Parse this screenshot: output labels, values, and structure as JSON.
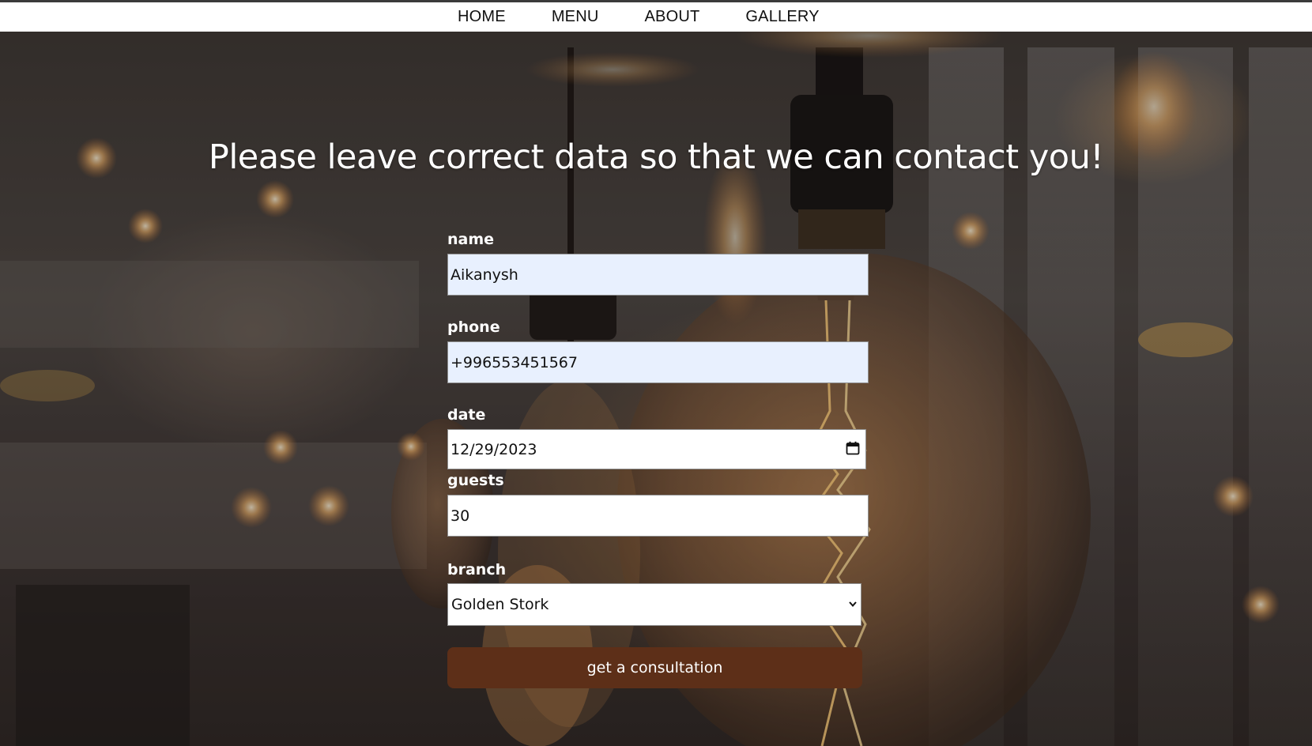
{
  "nav": {
    "items": [
      "HOME",
      "MENU",
      "ABOUT",
      "GALLERY"
    ]
  },
  "hero": {
    "title": "Please leave correct data so that we can contact you!"
  },
  "form": {
    "name": {
      "label": "name",
      "value": "Aikanysh"
    },
    "phone": {
      "label": "phone",
      "value": "+996553451567"
    },
    "date": {
      "label": "date",
      "value": "12/29/2023",
      "icon": "calendar-icon"
    },
    "guests": {
      "label": "guests",
      "value": "30"
    },
    "branch": {
      "label": "branch",
      "selected": "Golden Stork",
      "icon": "chevron-down-icon"
    },
    "submit_label": "get a consultation"
  },
  "colors": {
    "button": "#5d2f18",
    "autofill": "#e8f0fe",
    "navbar": "#ffffff",
    "heading": "#ffffff"
  }
}
